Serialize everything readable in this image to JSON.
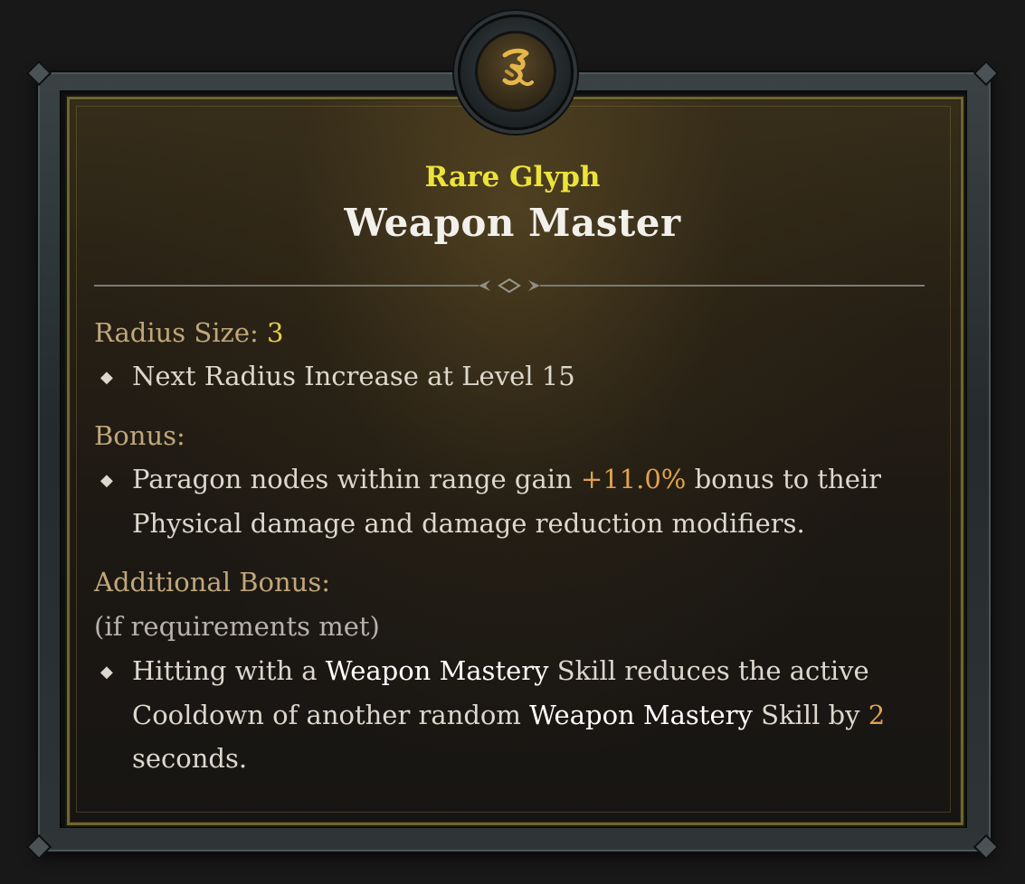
{
  "glyph": {
    "rarity": "Rare Glyph",
    "name": "Weapon Master",
    "emblem_icon": "glyph-rune-icon"
  },
  "radius": {
    "label": "Radius Size:",
    "value": "3",
    "next_increase": "Next Radius Increase at Level 15"
  },
  "bonus": {
    "label": "Bonus:",
    "line1_pre": "Paragon nodes within range gain ",
    "value": "+11.0%",
    "line1_post": " bonus to their",
    "line2": "Physical damage and damage reduction modifiers."
  },
  "additional_bonus": {
    "label": "Additional Bonus:",
    "requirement": "(if requirements met)",
    "line1_pre": "Hitting with a ",
    "skill_a": "Weapon Mastery",
    "line1_post": " Skill reduces the active",
    "line2_pre": "Cooldown of another random ",
    "skill_b": "Weapon Mastery",
    "line2_mid": " Skill by ",
    "seconds_value": "2",
    "line3": "seconds."
  },
  "colors": {
    "rarity_yellow": "#ece33a",
    "section_label": "#c0a77a",
    "highlight_orange": "#e2a24d",
    "frame_gold": "#6f6630"
  }
}
